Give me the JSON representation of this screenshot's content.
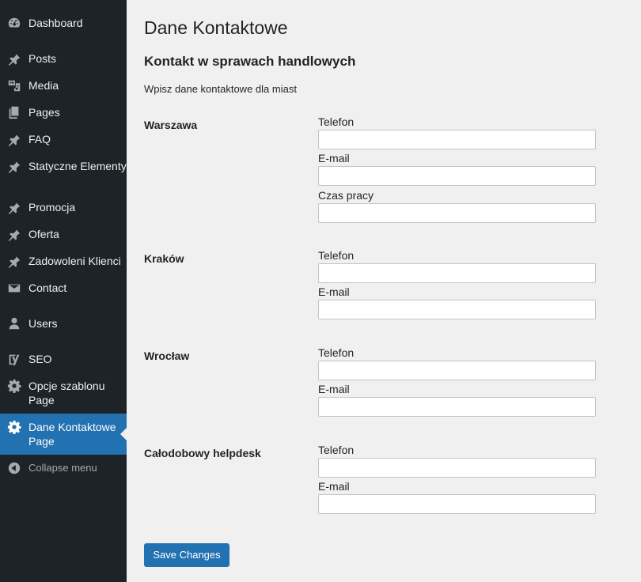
{
  "sidebar": {
    "items": [
      {
        "label": "Dashboard",
        "icon": "dashboard-icon"
      },
      {
        "label": "Posts",
        "icon": "pin-icon"
      },
      {
        "label": "Media",
        "icon": "media-icon"
      },
      {
        "label": "Pages",
        "icon": "pages-icon"
      },
      {
        "label": "FAQ",
        "icon": "pin-icon"
      },
      {
        "label": "Statyczne Elementy",
        "icon": "pin-icon"
      },
      {
        "label": "Promocja",
        "icon": "pin-icon"
      },
      {
        "label": "Oferta",
        "icon": "pin-icon"
      },
      {
        "label": "Zadowoleni Klienci",
        "icon": "pin-icon"
      },
      {
        "label": "Contact",
        "icon": "mail-icon"
      },
      {
        "label": "Users",
        "icon": "user-icon"
      },
      {
        "label": "SEO",
        "icon": "yoast-seo-icon"
      },
      {
        "label": "Opcje szablonu Page",
        "icon": "gear-icon"
      },
      {
        "label": "Dane Kontaktowe Page",
        "icon": "gear-icon",
        "current": true
      }
    ],
    "collapse_label": "Collapse menu",
    "colors": {
      "background": "#1d2327",
      "current": "#2271b1",
      "icon": "#a7aaad"
    }
  },
  "main": {
    "page_title": "Dane Kontaktowe",
    "section_title": "Kontakt w sprawach handlowych",
    "section_description": "Wpisz dane kontaktowe dla miast",
    "cities": [
      {
        "name": "Warszawa",
        "fields": [
          {
            "label": "Telefon",
            "value": ""
          },
          {
            "label": "E-mail",
            "value": ""
          },
          {
            "label": "Czas pracy",
            "value": ""
          }
        ]
      },
      {
        "name": "Kraków",
        "fields": [
          {
            "label": "Telefon",
            "value": ""
          },
          {
            "label": "E-mail",
            "value": ""
          }
        ]
      },
      {
        "name": "Wrocław",
        "fields": [
          {
            "label": "Telefon",
            "value": ""
          },
          {
            "label": "E-mail",
            "value": ""
          }
        ]
      },
      {
        "name": "Całodobowy helpdesk",
        "fields": [
          {
            "label": "Telefon",
            "value": ""
          },
          {
            "label": "E-mail",
            "value": ""
          }
        ]
      }
    ],
    "save_label": "Save Changes"
  }
}
